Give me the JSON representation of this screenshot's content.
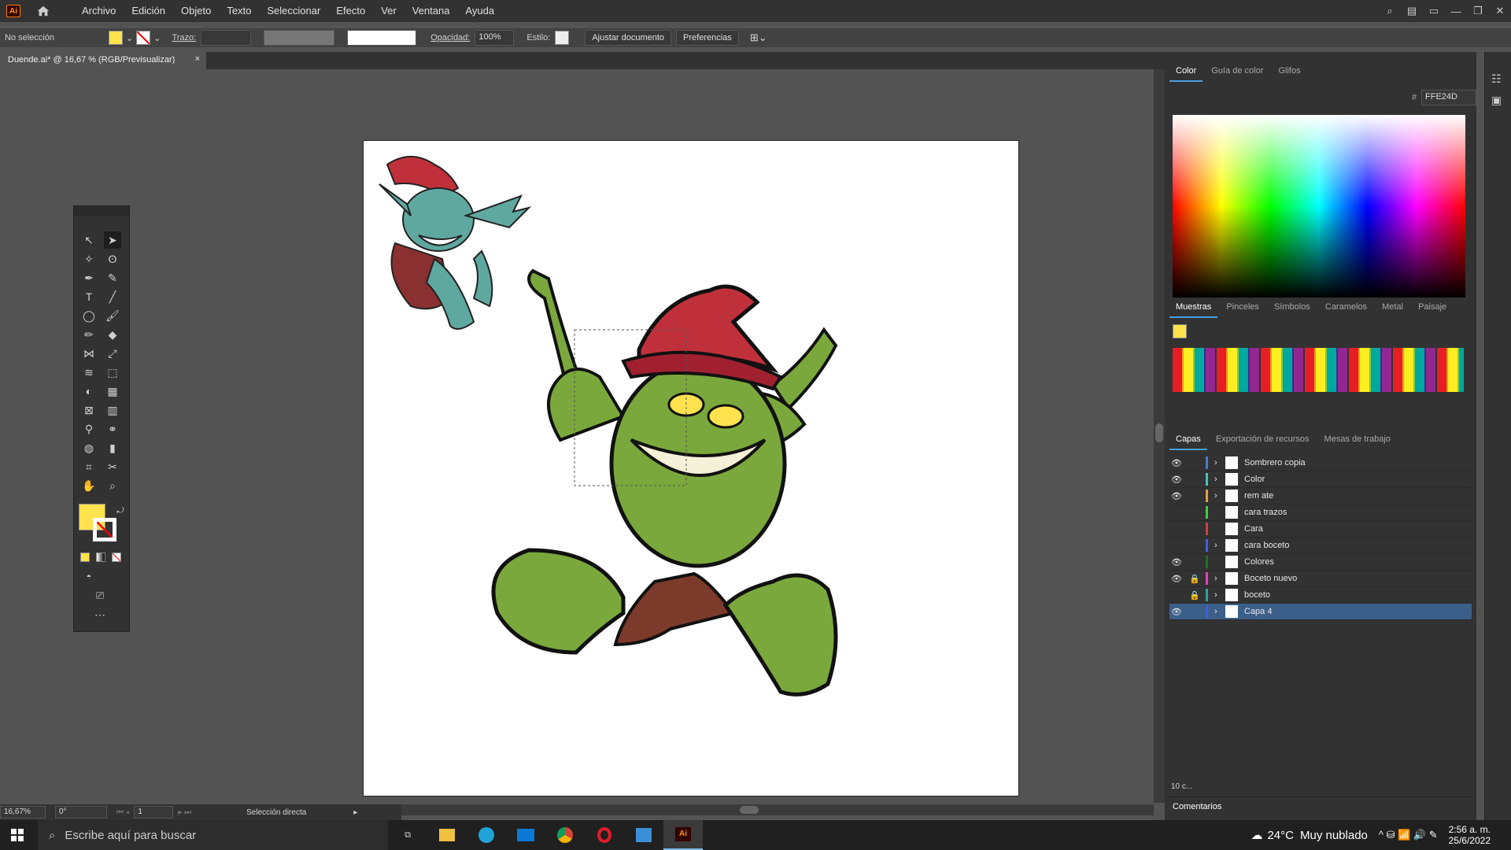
{
  "app": {
    "logo": "Ai"
  },
  "menu": [
    "Archivo",
    "Edición",
    "Objeto",
    "Texto",
    "Seleccionar",
    "Efecto",
    "Ver",
    "Ventana",
    "Ayuda"
  ],
  "control": {
    "selection": "No selección",
    "stroke_label": "Trazo:",
    "opacity_label": "Opacidad:",
    "opacity_value": "100%",
    "style_label": "Estilo:",
    "adjust_btn": "Ajustar documento",
    "prefs_btn": "Preferencias",
    "fill_color": "#ffe24d"
  },
  "document": {
    "tab_title": "Duende.ai* @ 16,67 % (RGB/Previsualizar)",
    "close": "×"
  },
  "status": {
    "zoom": "16,67%",
    "rotation": "0°",
    "artboard": "1",
    "tool": "Selección directa"
  },
  "color_panel": {
    "tabs": [
      "Color",
      "Guía de color",
      "Glifos"
    ],
    "hex_label": "#",
    "hex_value": "FFE24D"
  },
  "swatches_panel": {
    "tabs": [
      "Muestras",
      "Pinceles",
      "Símbolos",
      "Caramelos",
      "Metal",
      "Paisaje"
    ]
  },
  "layers_panel": {
    "tabs": [
      "Capas",
      "Exportación de recursos",
      "Mesas de trabajo"
    ],
    "layers": [
      {
        "name": "Sombrero copia",
        "color": "#4a7bd0"
      },
      {
        "name": "Color",
        "color": "#4ac0c0"
      },
      {
        "name": "rem ate",
        "color": "#e0a040"
      },
      {
        "name": "cara trazos",
        "color": "#40d040"
      },
      {
        "name": "Cara",
        "color": "#d04040"
      },
      {
        "name": "cara boceto",
        "color": "#4060e0"
      },
      {
        "name": "Colores",
        "color": "#207020"
      },
      {
        "name": "Boceto nuevo",
        "color": "#e040c0"
      },
      {
        "name": "boceto",
        "color": "#30a0a0"
      },
      {
        "name": "Capa 4",
        "color": "#4060e0"
      }
    ],
    "count": "10 c...",
    "comments": "Comentarios"
  },
  "taskbar": {
    "search_placeholder": "Escribe aquí para buscar",
    "weather_temp": "24°C",
    "weather_desc": "Muy nublado",
    "time": "2:56 a. m.",
    "date": "25/6/2022"
  }
}
